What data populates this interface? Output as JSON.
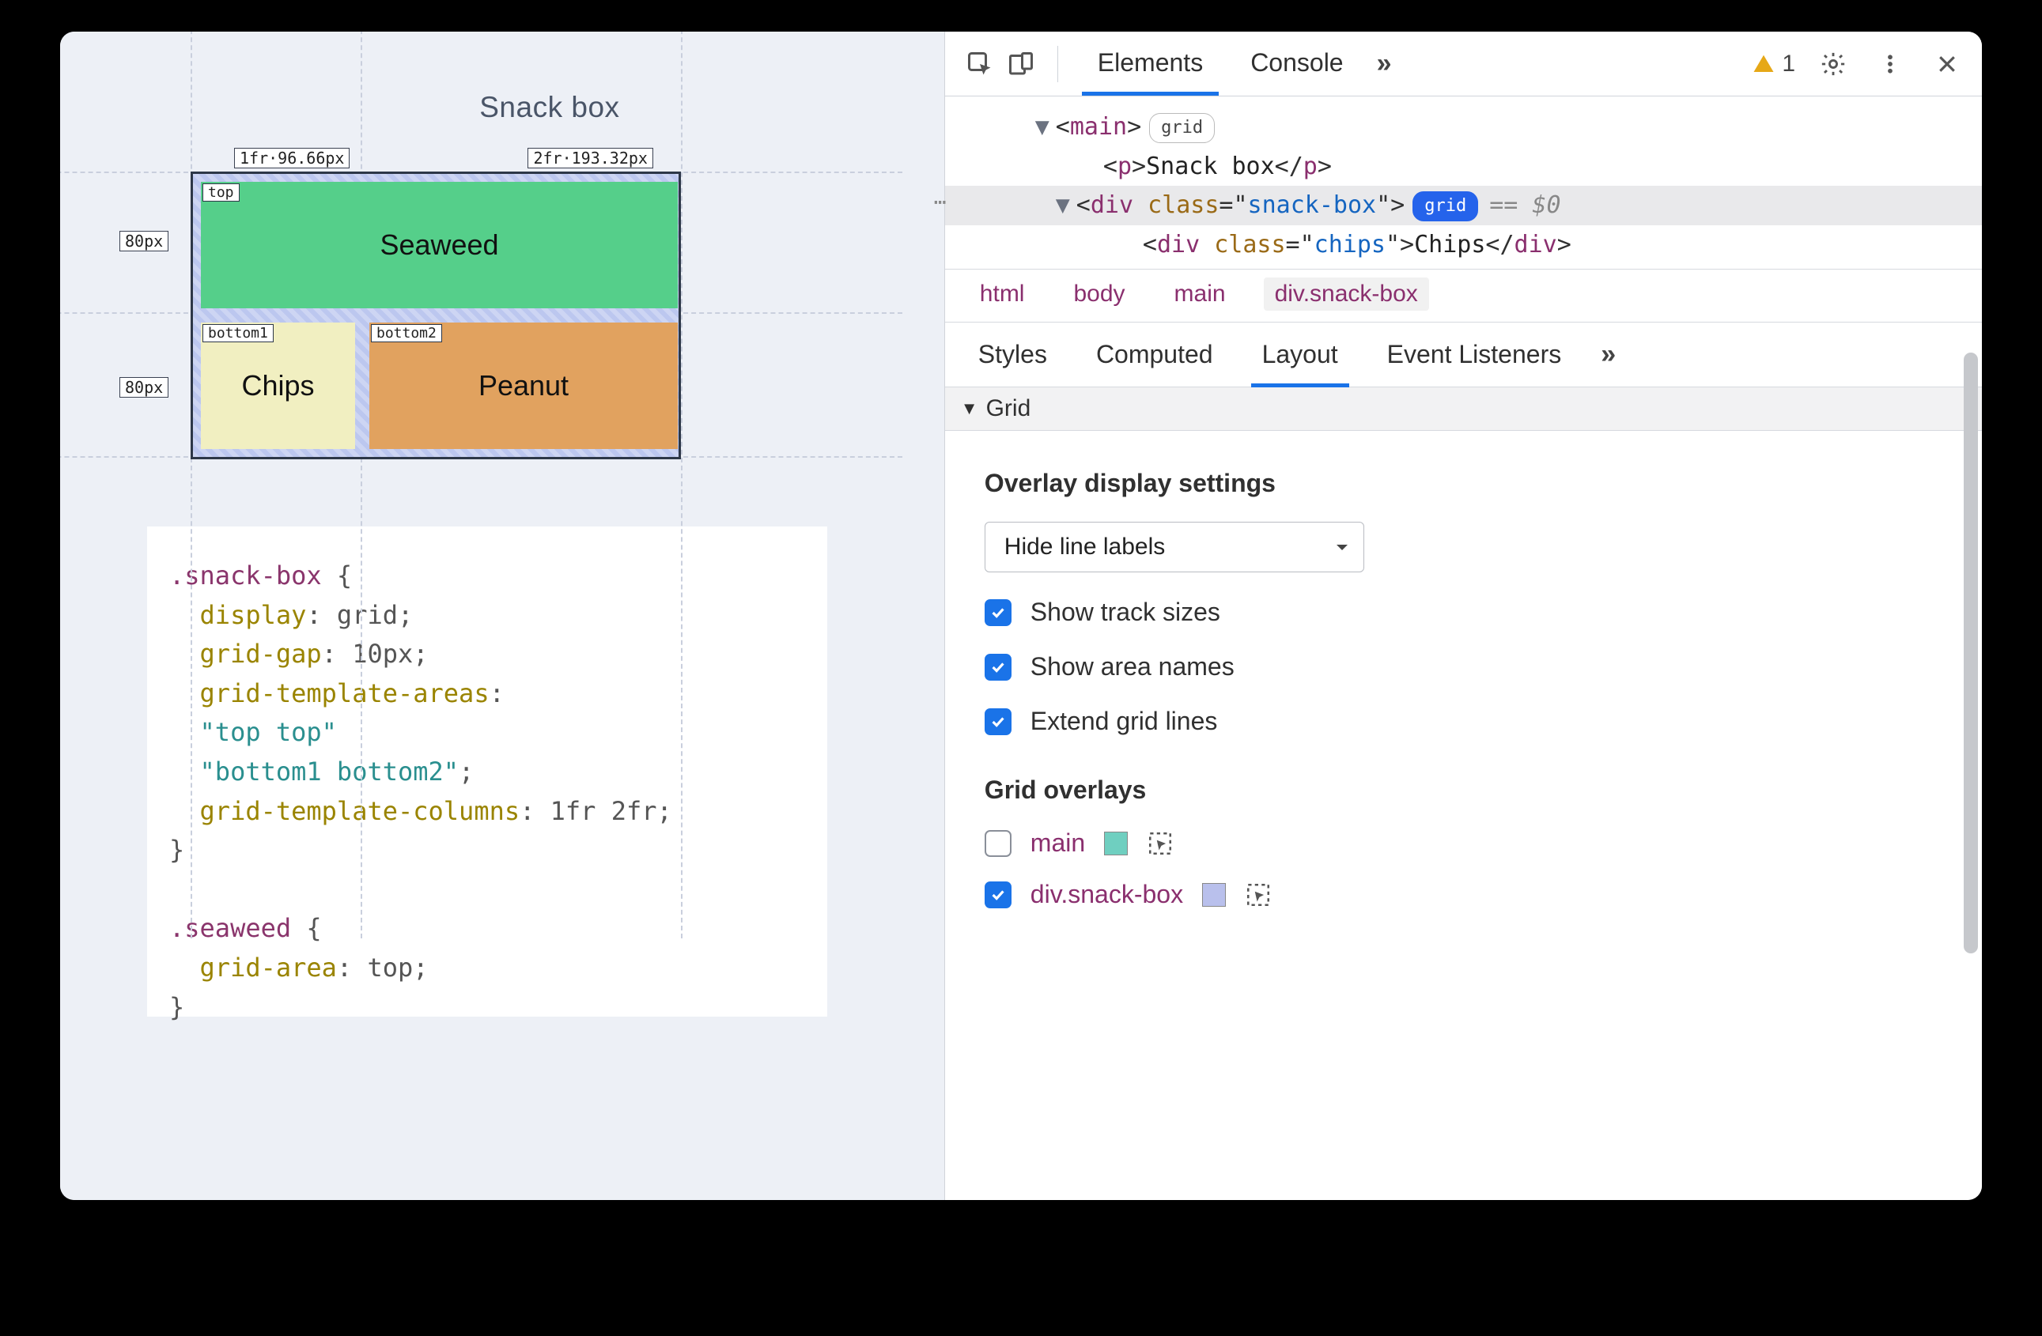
{
  "viewport": {
    "title": "Snack box",
    "col_labels": [
      "1fr·96.66px",
      "2fr·193.32px"
    ],
    "row_labels": [
      "80px",
      "80px"
    ],
    "areas": {
      "top": "top",
      "bottom1": "bottom1",
      "bottom2": "bottom2"
    },
    "cells": {
      "seaweed": "Seaweed",
      "chips": "Chips",
      "peanut": "Peanut"
    },
    "css_code": {
      "sel1": ".snack-box",
      "p_display": "display",
      "v_display": "grid",
      "p_gap": "grid-gap",
      "v_gap": "10px",
      "p_areas": "grid-template-areas",
      "v_areas_l1": "\"top top\"",
      "v_areas_l2": "\"bottom1 bottom2\"",
      "p_cols": "grid-template-columns",
      "v_cols": "1fr 2fr",
      "sel2": ".seaweed",
      "p_area": "grid-area",
      "v_area": "top"
    }
  },
  "devtools": {
    "toolbar": {
      "tabs": {
        "elements": "Elements",
        "console": "Console"
      },
      "warn_count": "1"
    },
    "dom": {
      "l1_tag": "main",
      "l1_badge": "grid",
      "l2_tag": "p",
      "l2_text": "Snack box",
      "l3_tag": "div",
      "l3_attr_name": "class",
      "l3_attr_val": "snack-box",
      "l3_badge": "grid",
      "l3_var": "== $0",
      "l4_tag": "div",
      "l4_attr_name": "class",
      "l4_attr_val": "chips",
      "l4_text": "Chips"
    },
    "crumbs": [
      "html",
      "body",
      "main",
      "div.snack-box"
    ],
    "subtabs": [
      "Styles",
      "Computed",
      "Layout",
      "Event Listeners"
    ],
    "grid_section": "Grid",
    "overlay_settings_title": "Overlay display settings",
    "select_value": "Hide line labels",
    "checks": {
      "track_sizes": "Show track sizes",
      "area_names": "Show area names",
      "extend_lines": "Extend grid lines"
    },
    "overlays_title": "Grid overlays",
    "overlays": {
      "main": {
        "label": "main",
        "color": "#6fcfc0",
        "checked": false
      },
      "snack": {
        "label": "div.snack-box",
        "color": "#b9c0ec",
        "checked": true
      }
    }
  }
}
